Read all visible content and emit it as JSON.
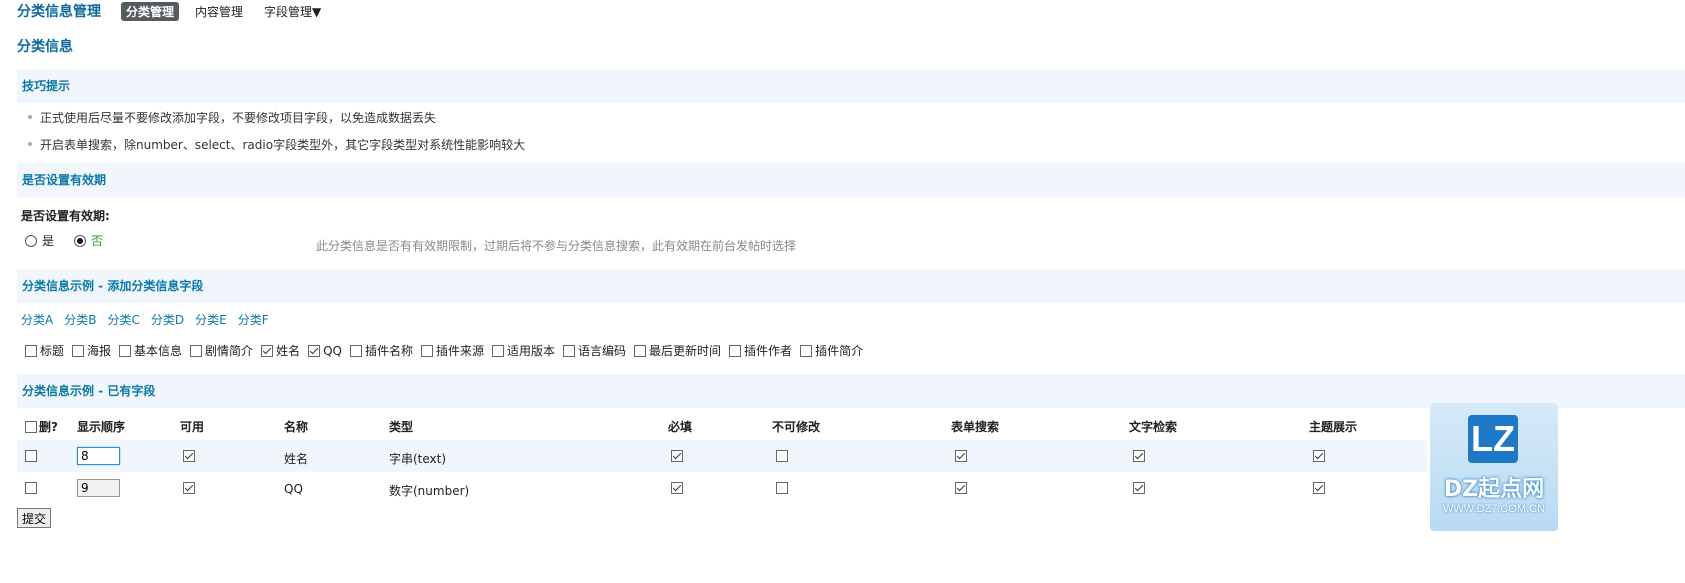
{
  "header": {
    "app_title": "分类信息管理",
    "nav": [
      "分类管理",
      "内容管理",
      "字段管理▼"
    ]
  },
  "page_title": "分类信息",
  "tips": {
    "heading": "技巧提示",
    "items": [
      "正式使用后尽量不要修改添加字段，不要修改项目字段，以免造成数据丢失",
      "开启表单搜索，除number、select、radio字段类型外，其它字段类型对系统性能影响较大"
    ]
  },
  "expiry": {
    "heading": "是否设置有效期",
    "label": "是否设置有效期:",
    "option_yes": "是",
    "option_no": "否",
    "selected": "否",
    "hint": "此分类信息是否有有效期限制，过期后将不参与分类信息搜索，此有效期在前台发帖时选择"
  },
  "example_add": {
    "heading": "分类信息示例 - 添加分类信息字段",
    "categories": [
      "分类A",
      "分类B",
      "分类C",
      "分类D",
      "分类E",
      "分类F"
    ],
    "fields": [
      {
        "label": "标题",
        "checked": false
      },
      {
        "label": "海报",
        "checked": false
      },
      {
        "label": "基本信息",
        "checked": false
      },
      {
        "label": "剧情简介",
        "checked": false
      },
      {
        "label": "姓名",
        "checked": true
      },
      {
        "label": "QQ",
        "checked": true
      },
      {
        "label": "插件名称",
        "checked": false
      },
      {
        "label": "插件来源",
        "checked": false
      },
      {
        "label": "适用版本",
        "checked": false
      },
      {
        "label": "语言编码",
        "checked": false
      },
      {
        "label": "最后更新时间",
        "checked": false
      },
      {
        "label": "插件作者",
        "checked": false
      },
      {
        "label": "插件简介",
        "checked": false
      }
    ]
  },
  "existing": {
    "heading": "分类信息示例 - 已有字段",
    "columns": {
      "delete": "删?",
      "order": "显示顺序",
      "available": "可用",
      "name": "名称",
      "type": "类型",
      "required": "必填",
      "readonly": "不可修改",
      "form_search": "表单搜索",
      "text_search": "文字检索",
      "subject_show": "主题展示"
    },
    "rows": [
      {
        "order": "8",
        "name": "姓名",
        "type": "字串(text)"
      },
      {
        "order": "9",
        "name": "QQ",
        "type": "数字(number)"
      }
    ],
    "submit": "提交"
  },
  "watermark": {
    "logo": "LZ",
    "name": "DZ起点网",
    "url": "WWW.DZ7.COM.CN"
  }
}
